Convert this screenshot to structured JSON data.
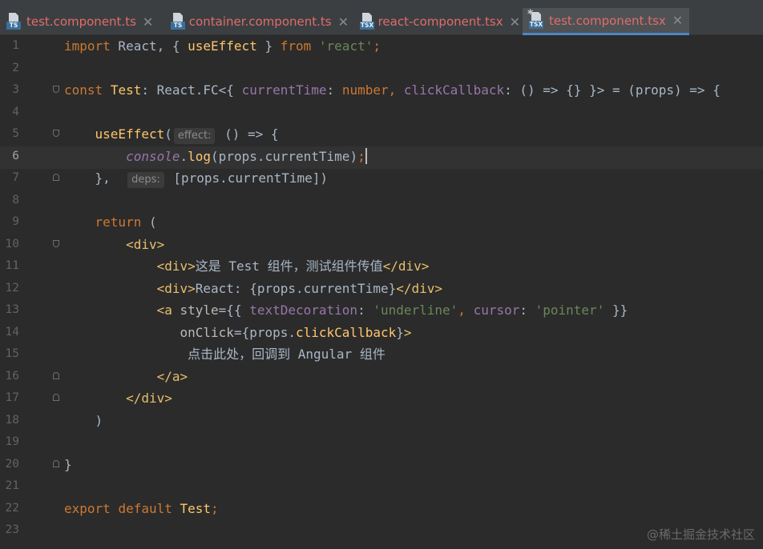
{
  "tabs": [
    {
      "label": "test.component.ts",
      "icon": "typescript-file-icon",
      "badge": "TS",
      "color": "#e06c6c",
      "active": false
    },
    {
      "label": "container.component.ts",
      "icon": "typescript-file-icon",
      "badge": "TS",
      "color": "#e06c6c",
      "active": false
    },
    {
      "label": "react-component.tsx",
      "icon": "tsx-file-icon",
      "badge": "TSX",
      "color": "#e06c6c",
      "active": false
    },
    {
      "label": "test.component.tsx",
      "icon": "tsx-file-icon",
      "badge": "TSX",
      "color": "#e06c6c",
      "active": true
    }
  ],
  "close_glyph": "✕",
  "modified_glyph": "*",
  "editor": {
    "current_line": "6",
    "lines": [
      {
        "n": "1",
        "t": [
          "import",
          " React, { ",
          "useEffect",
          " } ",
          "from",
          " ",
          "'react'",
          ";"
        ]
      },
      {
        "n": "2"
      },
      {
        "n": "3",
        "t": [
          "const",
          " ",
          "Test",
          ": React.FC<{ ",
          "currentTime",
          ": ",
          "number",
          ", ",
          "clickCallback",
          ": () => {} }> = (props) => {"
        ]
      },
      {
        "n": "4"
      },
      {
        "n": "5",
        "t": [
          "useEffect",
          "(",
          "effect:",
          " () => {"
        ]
      },
      {
        "n": "6",
        "t": [
          "console",
          ".",
          "log",
          "(props.currentTime)",
          ";"
        ]
      },
      {
        "n": "7",
        "t": [
          "},",
          "deps:",
          " [props.currentTime])"
        ]
      },
      {
        "n": "8"
      },
      {
        "n": "9",
        "t": [
          "return",
          " ("
        ]
      },
      {
        "n": "10",
        "t": [
          "<div>"
        ]
      },
      {
        "n": "11",
        "t": [
          "<div>",
          "这是 Test 组件，测试组件传值",
          "</div>"
        ]
      },
      {
        "n": "12",
        "t": [
          "<div>",
          "React: {props.currentTime}",
          "</div>"
        ]
      },
      {
        "n": "13",
        "t": [
          "<a ",
          "style",
          "={{ ",
          "textDecoration",
          ": ",
          "'underline'",
          ", ",
          "cursor",
          ": ",
          "'pointer'",
          " }}"
        ]
      },
      {
        "n": "14",
        "t": [
          "onClick",
          "={props.",
          "clickCallback",
          "}",
          ">"
        ]
      },
      {
        "n": "15",
        "t": [
          "点击此处，回调到 Angular 组件"
        ]
      },
      {
        "n": "16",
        "t": [
          "</a>"
        ]
      },
      {
        "n": "17",
        "t": [
          "</div>"
        ]
      },
      {
        "n": "18",
        "t": [
          ")"
        ]
      },
      {
        "n": "19"
      },
      {
        "n": "20",
        "t": [
          "}"
        ]
      },
      {
        "n": "21"
      },
      {
        "n": "22",
        "t": [
          "export",
          " ",
          "default",
          " Test",
          ";"
        ]
      },
      {
        "n": "23"
      }
    ]
  },
  "watermark": "@稀土掘金技术社区",
  "colors": {
    "background": "#2b2b2b",
    "keyword": "#cc7832",
    "function": "#ffc66d",
    "string": "#6a8759",
    "property": "#9876aa",
    "tag": "#e8bf6a",
    "text": "#a9b7c6",
    "tab_accent": "#4a88c7"
  }
}
